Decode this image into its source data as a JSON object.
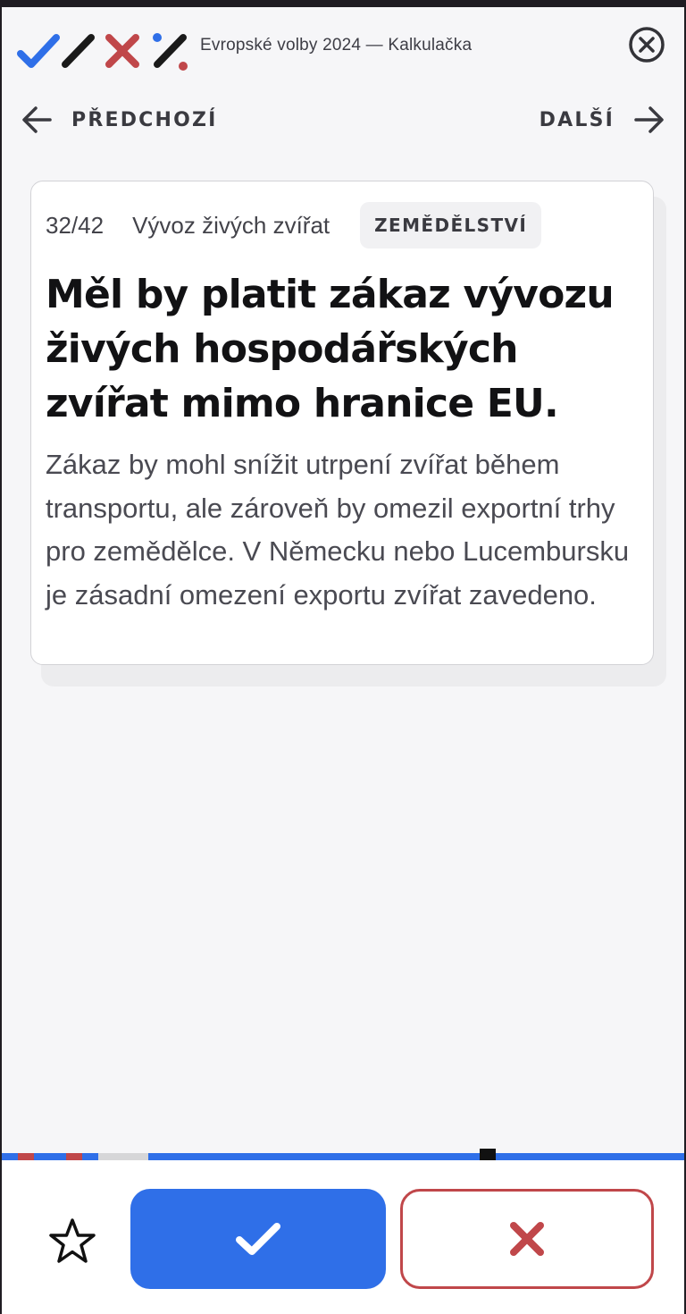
{
  "header": {
    "title": "Evropské volby 2024 — Kalkulačka",
    "logo_icon": "yes-no-marks-logo",
    "close_icon": "close-circle-icon"
  },
  "navigation": {
    "prev_label": "PŘEDCHOZÍ",
    "next_label": "DALŠÍ"
  },
  "question": {
    "counter": "32/42",
    "topic": "Vývoz živých zvířat",
    "category": "ZEMĚDĚLSTVÍ",
    "title": "Měl by platit zákaz vývozu živých hospodářských zvířat mimo hranice EU.",
    "description": "Zákaz by mohl snížit utrpení zvířat během transportu, ale zároveň by omezil exportní trhy pro zemědělce. V Německu nebo Lucembursku je zásadní omezení exportu zvířat zavedeno."
  },
  "progress": {
    "current": 32,
    "total": 42
  },
  "actions": {
    "star_icon": "star-outline-icon",
    "yes_icon": "checkmark-icon",
    "no_icon": "cross-icon"
  },
  "colors": {
    "accent_blue": "#2f6fe8",
    "no_red": "#c0474a",
    "background": "#f6f6f8"
  }
}
